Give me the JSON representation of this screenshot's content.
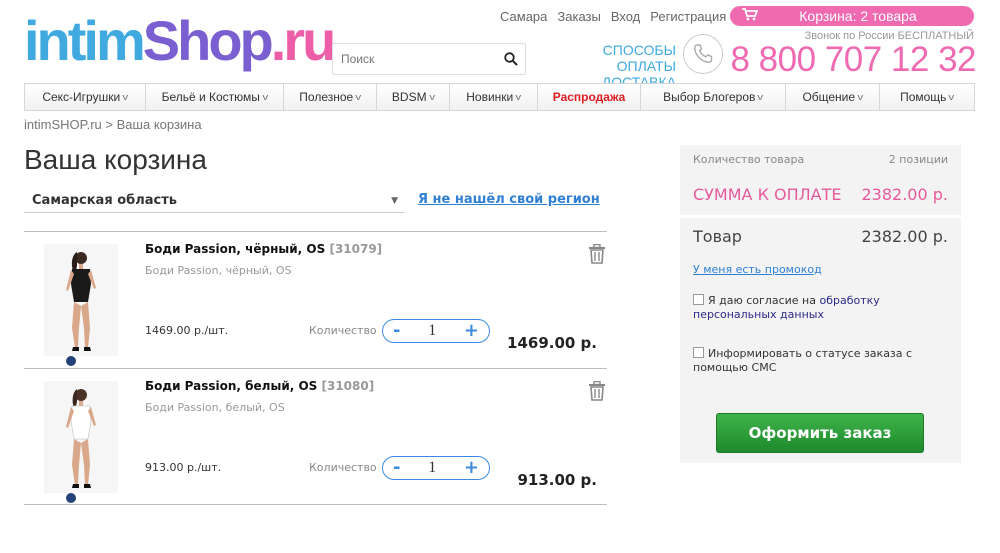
{
  "header": {
    "logo": {
      "part1": "intim",
      "part2": "Shop",
      "part3": ".ru"
    },
    "top_links": [
      "Самара",
      "Заказы",
      "Вход",
      "Регистрация"
    ],
    "cart_pill": "Корзина: 2 товара",
    "search_placeholder": "Поиск",
    "pay_link": "СПОСОБЫ ОПЛАТЫ",
    "delivery_link": "ДОСТАВКА",
    "phone_note": "Звонок по России БЕСПЛАТНЫЙ",
    "phone_number": "8 800 707 12 32"
  },
  "nav": [
    {
      "label": "Секс-Игрушки"
    },
    {
      "label": "Бельё и Костюмы"
    },
    {
      "label": "Полезное"
    },
    {
      "label": "BDSM"
    },
    {
      "label": "Новинки"
    },
    {
      "label": "Распродажа"
    },
    {
      "label": "Выбор Блогеров"
    },
    {
      "label": "Общение"
    },
    {
      "label": "Помощь"
    }
  ],
  "breadcrumb": {
    "home": "intimSHOP.ru",
    "separator": ">",
    "current": "Ваша корзина"
  },
  "page_title": "Ваша корзина",
  "region": {
    "selected": "Самарская область",
    "not_found_link": "Я не нашёл свой регион"
  },
  "cart_items": [
    {
      "name": "Боди Passion, чёрный, OS",
      "sku": "[31079]",
      "subtitle": "Боди Passion, чёрный, OS",
      "unit_price": "1469.00 р./шт.",
      "qty_label": "Количество",
      "qty": "1",
      "total": "1469.00 р."
    },
    {
      "name": "Боди Passion, белый, OS",
      "sku": "[31080]",
      "subtitle": "Боди Passion, белый, OS",
      "unit_price": "913.00 р./шт.",
      "qty_label": "Количество",
      "qty": "1",
      "total": "913.00 р."
    }
  ],
  "qty_controls": {
    "minus": "-",
    "plus": "+"
  },
  "summary": {
    "count_label": "Количество товара",
    "count_value": "2 позиции",
    "due_label": "СУММА К ОПЛАТЕ",
    "due_value": "2382.00 р.",
    "goods_label": "Товар",
    "goods_value": "2382.00 р.",
    "promo_link": "У меня есть промокод",
    "consent_text": "Я даю согласие на",
    "consent_link1": "обработку",
    "consent_link2": "персональных данных",
    "sms_text": "Информировать о статусе заказа с помощью СМС",
    "checkout_button": "Оформить заказ"
  },
  "colors": {
    "brand_pink": "#ef6ab1",
    "link_blue": "#2f7fd4",
    "sale_red": "#e01c24",
    "checkout_green": "#1e8a2c"
  }
}
